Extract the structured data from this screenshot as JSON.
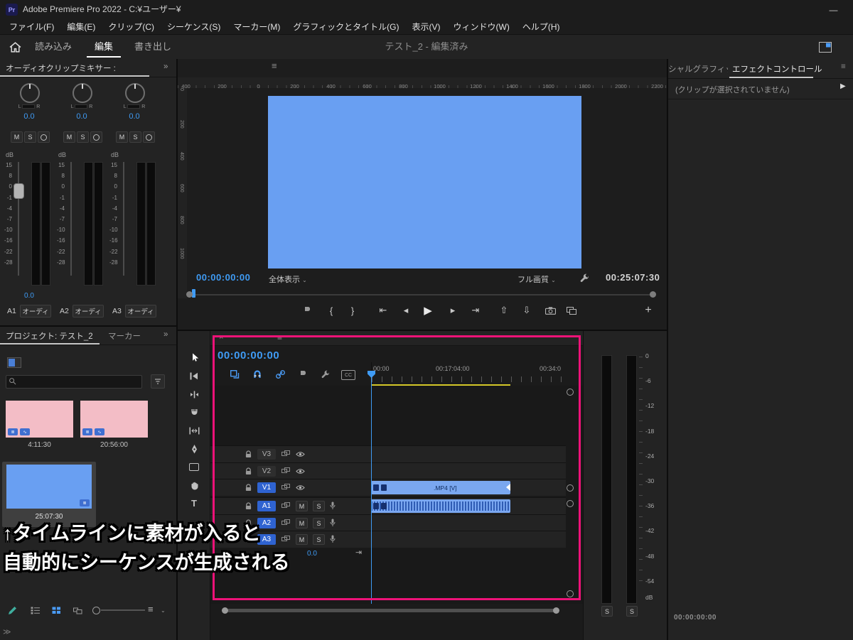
{
  "window": {
    "title": "Adobe Premiere Pro 2022 - C:¥ユーザー¥",
    "app_badge": "Pr",
    "minimize_glyph": "—"
  },
  "menubar": {
    "items": [
      "ファイル(F)",
      "編集(E)",
      "クリップ(C)",
      "シーケンス(S)",
      "マーカー(M)",
      "グラフィックとタイトル(G)",
      "表示(V)",
      "ウィンドウ(W)",
      "ヘルプ(H)"
    ]
  },
  "workspace": {
    "tabs": [
      {
        "label": "読み込み"
      },
      {
        "label": "編集"
      },
      {
        "label": "書き出し"
      }
    ],
    "active_tab": "編集",
    "doc_title": "テスト_2 - 編集済み"
  },
  "glyphs": {
    "caret": "⌄",
    "chevrons": "»",
    "menu": "≡",
    "close": "×",
    "to_right": "⇥",
    "expand": "▶",
    "corner": "≫"
  },
  "mixer": {
    "tab": "オーディオクリップミキサー :",
    "db_label": "dB",
    "scale": [
      "15",
      "8",
      "0",
      "-1",
      "-4",
      "-7",
      "-10",
      "-16",
      "-22",
      "-28"
    ],
    "pan_left": "L",
    "pan_right": "R",
    "channels": [
      {
        "value": "0.0",
        "mute": "M",
        "solo": "S",
        "fader_value": "0.0",
        "track": "A1",
        "name": "オーディ"
      },
      {
        "value": "0.0",
        "mute": "M",
        "solo": "S",
        "track": "A2",
        "name": "オーディ"
      },
      {
        "value": "0.0",
        "mute": "M",
        "solo": "S",
        "track": "A3",
        "name": "オーディ"
      }
    ]
  },
  "project": {
    "tab": "プロジェクト: テスト_2",
    "tab_marker": "マーカー",
    "items": [
      {
        "duration": "4:11:30"
      },
      {
        "duration": "20:56:00"
      },
      {
        "duration": "25:07:30"
      }
    ]
  },
  "program": {
    "ruler_top": [
      "400",
      "200",
      "0",
      "200",
      "400",
      "600",
      "800",
      "1000",
      "1200",
      "1400",
      "1600",
      "1800",
      "2000",
      "2200"
    ],
    "ruler_left": [
      "0",
      "200",
      "400",
      "600",
      "800",
      "1000"
    ],
    "timecode": "00:00:00:00",
    "fit_select": "全体表示",
    "quality_select": "フル画質",
    "duration": "00:25:07:30",
    "transport": {
      "mark_in": "{",
      "mark_out": "}",
      "go_in": "⇤",
      "step_back": "◂",
      "play": "▶",
      "step_fwd": "▸",
      "go_out": "⇥",
      "lift": "⇧",
      "extract": "⇩",
      "add": "+"
    }
  },
  "timeline": {
    "timecode": "00:00:00:00",
    "ruler": [
      "00:00",
      "00:17:04:00",
      "00:34:0"
    ],
    "cc_label": "CC",
    "tracks_video": [
      {
        "label": "V3"
      },
      {
        "label": "V2"
      },
      {
        "label": "V1"
      }
    ],
    "tracks_audio": [
      {
        "label": "A1"
      },
      {
        "label": "A2"
      },
      {
        "label": "A3"
      }
    ],
    "mute_label": "M",
    "solo_label": "S",
    "clip_label": ".MP4 [V]",
    "master_gain": "0.0",
    "type_tool_glyph": "T"
  },
  "meters": {
    "scale": [
      "0",
      "-6",
      "-12",
      "-18",
      "-24",
      "-30",
      "-36",
      "-42",
      "-48",
      "-54"
    ],
    "db_label": "dB",
    "solo_label": "S"
  },
  "effects": {
    "tab_clipped": "シャルグラフィックス",
    "tab": "エフェクトコントロール",
    "empty_message": "(クリップが選択されていません)",
    "timecode": "00:00:00:00"
  },
  "caption": {
    "line1": "↑タイムラインに素材が入ると",
    "line2": "自動的にシーケンスが生成される"
  },
  "colors": {
    "accent_blue": "#3f9bf4",
    "clip_blue": "#7aa7f0",
    "preview_blue": "#699ff2",
    "thumb_pink": "#f3bdc6",
    "highlight_pink": "#ed1278",
    "work_bar_yellow": "#d4c728"
  }
}
